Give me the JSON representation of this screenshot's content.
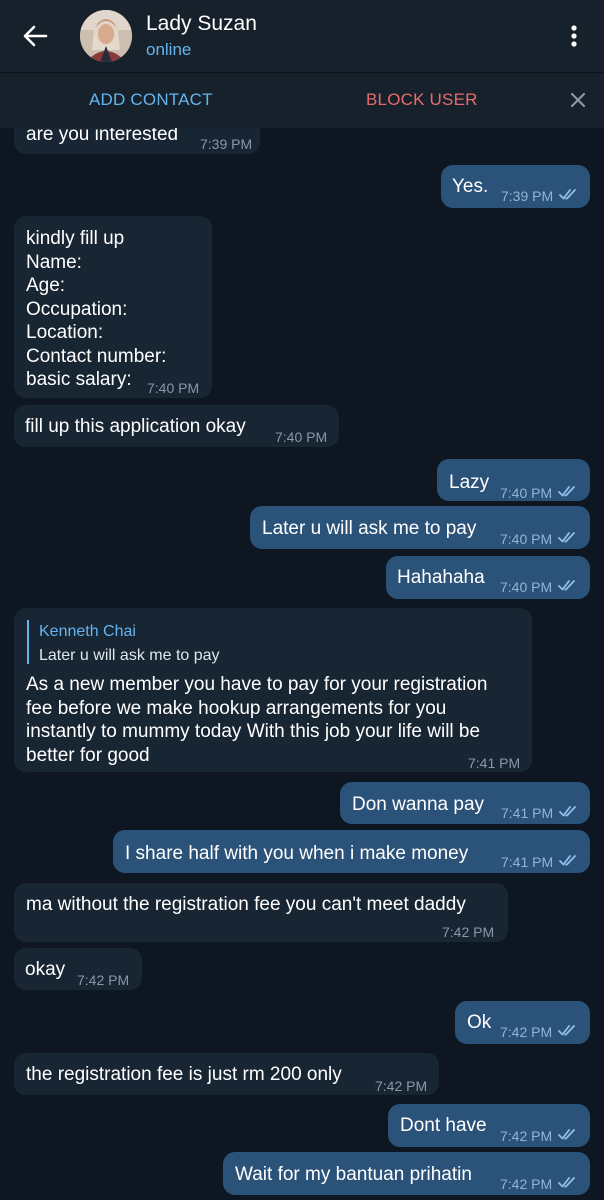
{
  "header": {
    "name": "Lady Suzan",
    "status": "online",
    "back_icon": "arrow-left-icon",
    "more_icon": "more-vertical-icon"
  },
  "actions": {
    "add_contact": "ADD CONTACT",
    "block_user": "BLOCK USER",
    "close_icon": "close-icon"
  },
  "colors": {
    "background": "#0e1621",
    "header": "#17212b",
    "incoming": "#182533",
    "outgoing": "#2b5278",
    "accent": "#64b5ef",
    "danger": "#e56c6c"
  },
  "messages": [
    {
      "dir": "in",
      "text": "are you interested",
      "time": "7:39 PM"
    },
    {
      "dir": "out",
      "text": "Yes.",
      "time": "7:39 PM",
      "read": true
    },
    {
      "dir": "in",
      "text": "kindly fill up\nName:\nAge:\nOccupation:\nLocation:\nContact number:\nbasic salary:",
      "time": "7:40 PM"
    },
    {
      "dir": "in",
      "text": "fill up this application okay",
      "time": "7:40 PM"
    },
    {
      "dir": "out",
      "text": "Lazy",
      "time": "7:40 PM",
      "read": true
    },
    {
      "dir": "out",
      "text": "Later u will ask me to pay",
      "time": "7:40 PM",
      "read": true
    },
    {
      "dir": "out",
      "text": "Hahahaha",
      "time": "7:40 PM",
      "read": true
    },
    {
      "dir": "in",
      "reply_to": {
        "name": "Kenneth Chai",
        "text": "Later u will ask me to pay"
      },
      "text": "As a new member you have to pay for your registration\nfee before we make hookup arrangements for you\ninstantly to mummy today With this job your life will be\nbetter for good",
      "time": "7:41 PM"
    },
    {
      "dir": "out",
      "text": "Don wanna pay",
      "time": "7:41 PM",
      "read": true
    },
    {
      "dir": "out",
      "text": "I share half with you when i make money",
      "time": "7:41 PM",
      "read": true
    },
    {
      "dir": "in",
      "text": "ma without the registration fee you can't meet daddy",
      "time": "7:42 PM"
    },
    {
      "dir": "in",
      "text": "okay",
      "time": "7:42 PM"
    },
    {
      "dir": "out",
      "text": "Ok",
      "time": "7:42 PM",
      "read": true
    },
    {
      "dir": "in",
      "text": "the registration fee is just rm 200 only",
      "time": "7:42 PM"
    },
    {
      "dir": "out",
      "text": "Dont have",
      "time": "7:42 PM",
      "read": true
    },
    {
      "dir": "out",
      "text": "Wait for my bantuan prihatin",
      "time": "7:42 PM",
      "read": true
    }
  ]
}
